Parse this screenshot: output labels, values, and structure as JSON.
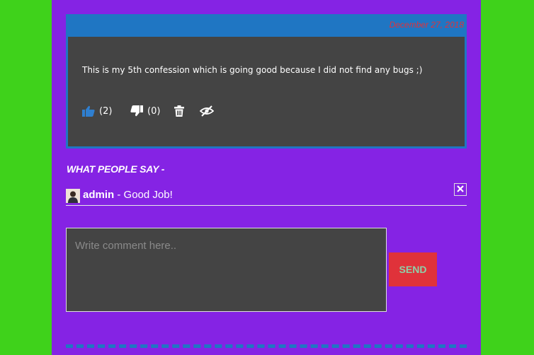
{
  "confession": {
    "date": "December 27, 2018",
    "text": "This is my 5th confession which is going good because I did not find any bugs ;)",
    "likes": "(2)",
    "dislikes": "(0)"
  },
  "icons": {
    "like": "thumbs-up-icon",
    "dislike": "thumbs-down-icon",
    "delete": "trash-icon",
    "hide": "eye-slash-icon",
    "close": "close-icon"
  },
  "comments_section": {
    "title": "WHAT PEOPLE SAY -",
    "items": [
      {
        "author": "admin",
        "separator": " - ",
        "text": "Good Job!"
      }
    ]
  },
  "comment_form": {
    "placeholder": "Write comment here..",
    "send_label": "SEND"
  },
  "colors": {
    "page_bg": "#3fd21b",
    "panel_bg": "#8523e4",
    "card_bg": "#1f76c3",
    "body_bg": "#444444",
    "accent_red": "#e0323a"
  }
}
